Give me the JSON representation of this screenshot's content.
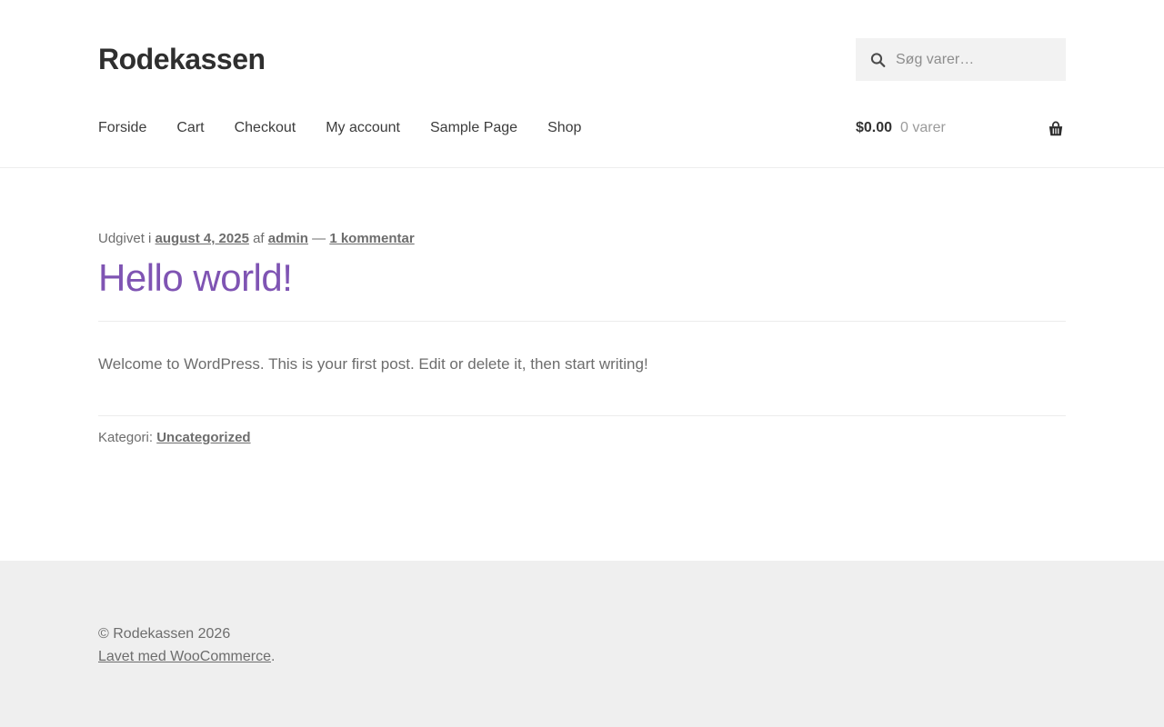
{
  "header": {
    "site_title": "Rodekassen",
    "search": {
      "placeholder": "Søg varer…"
    },
    "nav": [
      "Forside",
      "Cart",
      "Checkout",
      "My account",
      "Sample Page",
      "Shop"
    ],
    "cart": {
      "amount": "$0.00",
      "count_label": "0 varer"
    }
  },
  "article": {
    "meta": {
      "published_prefix": "Udgivet i",
      "date": "august 4, 2025",
      "author_prefix": "af",
      "author": "admin",
      "separator": "—",
      "comments": "1 kommentar"
    },
    "title": "Hello world!",
    "body": "Welcome to WordPress. This is your first post. Edit or delete it, then start writing!",
    "category_label": "Kategori:",
    "category": "Uncategorized"
  },
  "footer": {
    "copyright": "© Rodekassen 2026",
    "credit_link": "Lavet med WooCommerce",
    "credit_suffix": "."
  },
  "colors": {
    "accent": "#7f54b3",
    "heading_text": "#2f2f2f",
    "body_text": "#6d6d6d",
    "footer_bg": "#efefef",
    "search_bg": "#f2f2f2",
    "divider": "#ececec"
  }
}
